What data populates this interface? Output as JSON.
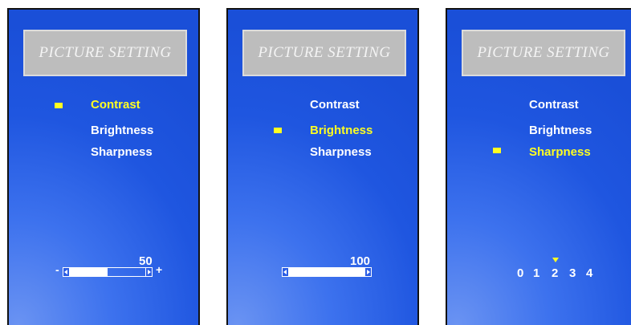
{
  "panels": [
    {
      "title": "PICTURE SETTING",
      "menu": [
        "Contrast",
        "Brightness",
        "Sharpness"
      ],
      "selected": "Contrast",
      "value": "50",
      "slider_level": 0.5,
      "minus_sign": "-",
      "plus_sign": "+"
    },
    {
      "title": "PICTURE SETTING",
      "menu": [
        "Contrast",
        "Brightness",
        "Sharpness"
      ],
      "selected": "Brightness",
      "value": "100",
      "slider_level": 1.0
    },
    {
      "title": "PICTURE SETTING",
      "menu": [
        "Contrast",
        "Brightness",
        "Sharpness"
      ],
      "selected": "Sharpness",
      "options": [
        "0",
        "1",
        "2",
        "3",
        "4"
      ],
      "selected_option": "2"
    }
  ],
  "colors": {
    "highlight": "#ffff22",
    "background": "#1f56e0",
    "title_box": "#bdbdbd"
  }
}
